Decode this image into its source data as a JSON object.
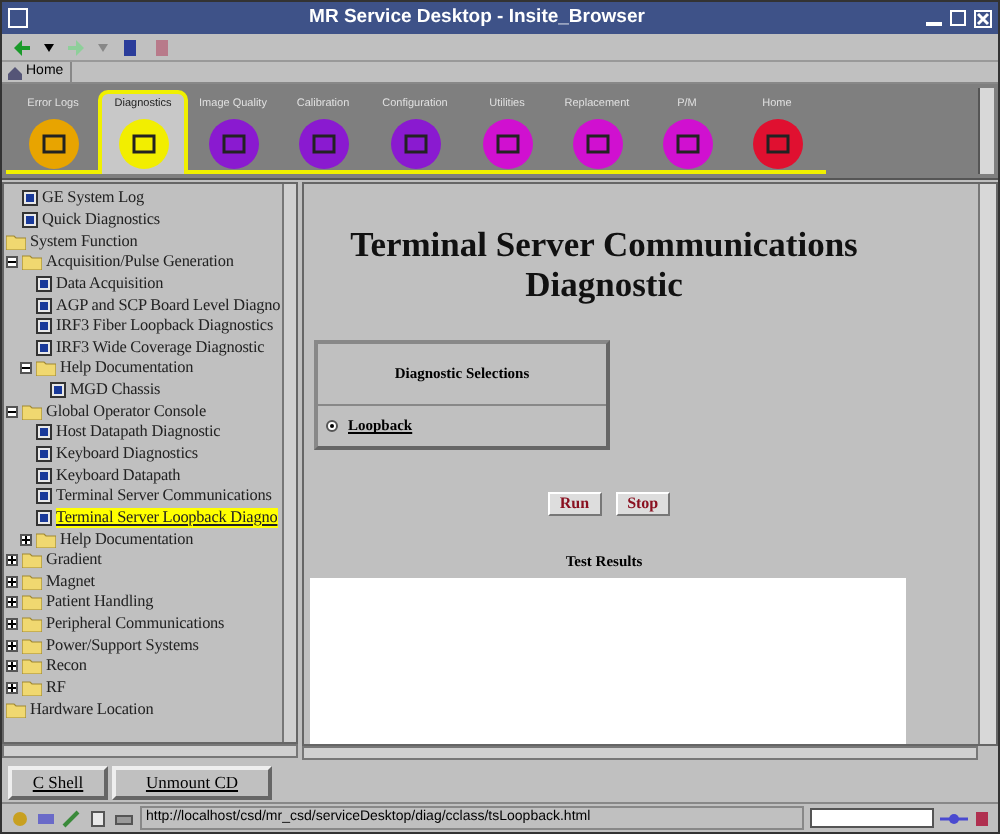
{
  "window": {
    "title": "MR Service Desktop - Insite_Browser"
  },
  "toolbar": {
    "home_link": "Home"
  },
  "tabs": [
    {
      "label": "Error Logs",
      "color": "#e8a400",
      "selected": false
    },
    {
      "label": "Diagnostics",
      "color": "#f2ee00",
      "selected": true
    },
    {
      "label": "Image Quality",
      "color": "#8a1ad0",
      "selected": false
    },
    {
      "label": "Calibration",
      "color": "#8a1ad0",
      "selected": false
    },
    {
      "label": "Configuration",
      "color": "#8a1ad0",
      "selected": false
    },
    {
      "label": "Utilities",
      "color": "#d010d0",
      "selected": false
    },
    {
      "label": "Replacement",
      "color": "#d010d0",
      "selected": false
    },
    {
      "label": "P/M",
      "color": "#d010d0",
      "selected": false
    },
    {
      "label": "Home",
      "color": "#e01030",
      "selected": false
    }
  ],
  "tree": [
    {
      "label": "GE System Log",
      "kind": "page",
      "selected": false
    },
    {
      "label": "Quick Diagnostics",
      "kind": "page",
      "selected": false
    },
    {
      "label": "System Function",
      "kind": "root-folder",
      "children": [
        {
          "label": "Acquisition/Pulse Generation",
          "kind": "folder",
          "expanded": true,
          "children": [
            {
              "label": "Data Acquisition",
              "kind": "page",
              "selected": false
            },
            {
              "label": "AGP and SCP Board Level Diagno",
              "kind": "page",
              "selected": false
            },
            {
              "label": "IRF3 Fiber Loopback Diagnostics",
              "kind": "page",
              "selected": false
            },
            {
              "label": "IRF3 Wide Coverage Diagnostic",
              "kind": "page",
              "selected": false
            },
            {
              "label": "Help Documentation",
              "kind": "folder",
              "expanded": true,
              "children": [
                {
                  "label": "MGD Chassis",
                  "kind": "page",
                  "selected": false
                }
              ]
            }
          ]
        },
        {
          "label": "Global Operator Console",
          "kind": "folder",
          "expanded": true,
          "children": [
            {
              "label": "Host Datapath Diagnostic",
              "kind": "page",
              "selected": false
            },
            {
              "label": "Keyboard Diagnostics",
              "kind": "page",
              "selected": false
            },
            {
              "label": "Keyboard Datapath",
              "kind": "page",
              "selected": false
            },
            {
              "label": "Terminal Server Communications",
              "kind": "page",
              "selected": false
            },
            {
              "label": "Terminal Server Loopback Diagno",
              "kind": "page",
              "selected": true
            },
            {
              "label": "Help Documentation",
              "kind": "folder",
              "expanded": false
            }
          ]
        },
        {
          "label": "Gradient",
          "kind": "folder",
          "expanded": false
        },
        {
          "label": "Magnet",
          "kind": "folder",
          "expanded": false
        },
        {
          "label": "Patient Handling",
          "kind": "folder",
          "expanded": false
        },
        {
          "label": "Peripheral Communications",
          "kind": "folder",
          "expanded": false
        },
        {
          "label": "Power/Support Systems",
          "kind": "folder",
          "expanded": false
        },
        {
          "label": "Recon",
          "kind": "folder",
          "expanded": false
        },
        {
          "label": "RF",
          "kind": "folder",
          "expanded": false
        }
      ]
    },
    {
      "label": "Hardware Location",
      "kind": "root-folder"
    }
  ],
  "content": {
    "title": "Terminal Server Communications Diagnostic",
    "selections": {
      "heading": "Diagnostic Selections",
      "options": [
        {
          "label": "Loopback",
          "selected": true
        }
      ]
    },
    "buttons": [
      "Run",
      "Stop"
    ],
    "results": {
      "heading": "Test Results"
    }
  },
  "bottom_buttons": [
    "C Shell",
    "Unmount CD"
  ],
  "status_bar": {
    "url": "http://localhost/csd/mr_csd/serviceDesktop/diag/cclass/tsLoopback.html"
  }
}
